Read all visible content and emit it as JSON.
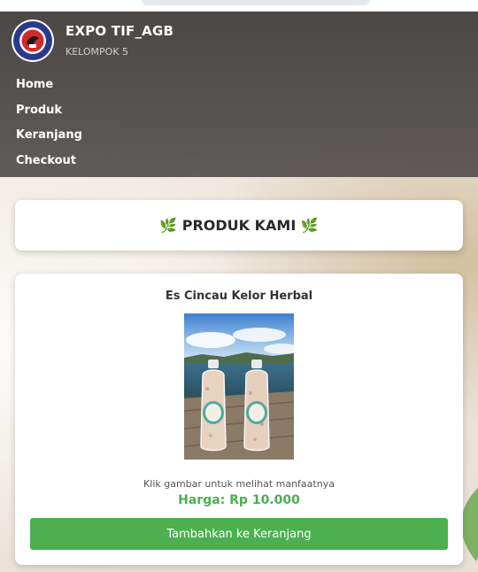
{
  "site": {
    "title": "EXPO TIF_AGB",
    "subtitle": "KELOMPOK 5"
  },
  "nav": {
    "items": [
      {
        "label": "Home"
      },
      {
        "label": "Produk"
      },
      {
        "label": "Keranjang"
      },
      {
        "label": "Checkout"
      }
    ]
  },
  "section": {
    "title": "🌿 PRODUK KAMI 🌿"
  },
  "product": {
    "name": "Es Cincau Kelor Herbal",
    "image_hint": "Klik gambar untuk melihat manfaatnya",
    "price": "Harga: Rp 10.000",
    "add_button_label": "Tambahkan ke Keranjang"
  },
  "colors": {
    "accent": "#4caf50",
    "header_bg": "#4a4644"
  },
  "icons": [
    "university-logo",
    "leaf-icon"
  ]
}
